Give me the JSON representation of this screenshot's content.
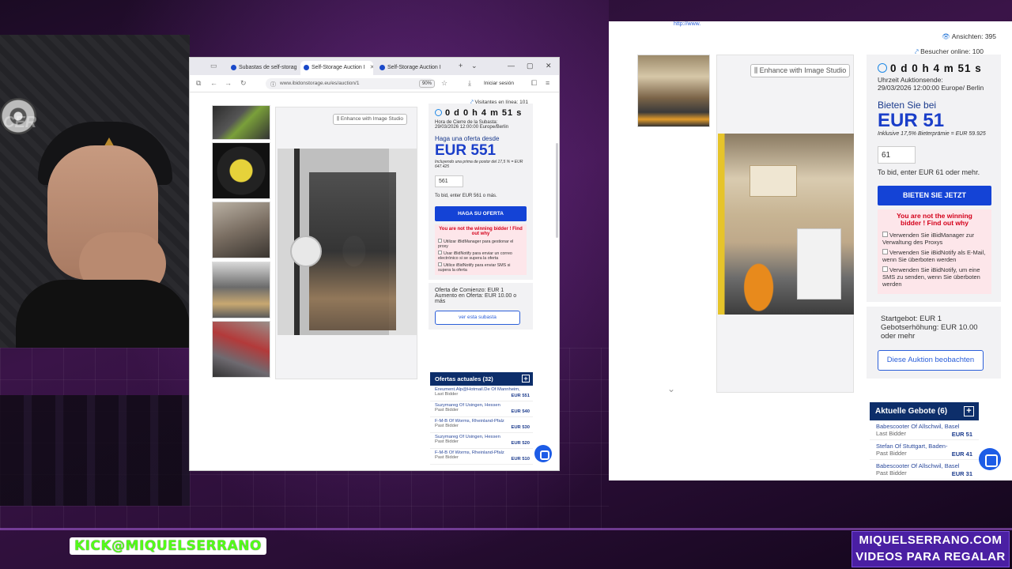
{
  "browser": {
    "tabs": [
      {
        "label": "Subastas de self-storag"
      },
      {
        "label": "Self-Storage Auction I"
      },
      {
        "label": "Self-Storage Auction I"
      }
    ],
    "url": "www.ibidonstorage.eu/es/auction/1",
    "zoom": "90%",
    "signin_label": "Iniciar sesión",
    "visitors_label": "Visitantes en línea: 101"
  },
  "auction_es": {
    "enhance_label": "Enhance with Image Studio",
    "timer": "0 d 0 h 4 m 51 s",
    "closing_label": "Hora de Cierre de la Subasta:",
    "closing_value": "29/03/2026 12:00:00 Europe/Berlin",
    "bid_from_label": "Haga una oferta desde",
    "price": "EUR 551",
    "premium_note": "Incluyendo una prima de postor del 17,5 % = EUR 647.425",
    "bid_value": "561",
    "to_bid_hint": "To bid, enter EUR 561 o más.",
    "bid_button": "HAGA SU OFERTA",
    "not_winning": "You are not the winning bidder ! Find out why",
    "options": [
      "Utilizar iBidManager para gestionar el proxy",
      "Usar iBidNotify para enviar un correo electrónico si se supera la oferta",
      "Utilice iBidNotify para enviar SMS si supera la oferta"
    ],
    "start_bid": "Oferta de Comienzo: EUR 1",
    "increment": "Aumento en Oferta: EUR 10.00 o más",
    "watch_button": "ver esta subasta",
    "offers_header": "Ofertas actuales (32)",
    "offers": [
      {
        "who": "Ereument.Alp@Hotmail.De Of Mannheim,",
        "status": "Last Bidder",
        "amount": "EUR 551"
      },
      {
        "who": "Suzymareg Of Usingen, Hessen",
        "status": "Past Bidder",
        "amount": "EUR 540"
      },
      {
        "who": "F-M-B Of Worms, Rheinland-Pfalz",
        "status": "Past Bidder",
        "amount": "EUR 530"
      },
      {
        "who": "Suzymareg Of Usingen, Hessen",
        "status": "Past Bidder",
        "amount": "EUR 520"
      },
      {
        "who": "F-M-B Of Worms, Rheinland-Pfalz",
        "status": "Past Bidder",
        "amount": "EUR 510"
      }
    ]
  },
  "auction_de": {
    "link": "http://www.",
    "views": "Ansichten: 395",
    "online": "Besucher online: 100",
    "enhance_label": "Enhance with Image Studio",
    "timer": "0 d 0 h 4 m 51 s",
    "closing_label": "Uhrzeit Auktionsende:",
    "closing_value": "29/03/2026 12:00:00 Europe/ Berlin",
    "bid_from_label": "Bieten Sie bei",
    "price": "EUR 51",
    "premium_note": "Inklusive 17,5% Bieterprämie = EUR 59.925",
    "bid_value": "61",
    "to_bid_hint": "To bid, enter EUR 61 oder mehr.",
    "bid_button": "BIETEN SIE JETZT",
    "not_winning_line1": "You are not the winning",
    "not_winning_line2": "bidder ! Find out why",
    "options": [
      "Verwenden Sie iBidManager zur Verwaltung des Proxys",
      "Verwenden Sie iBidNotify als E-Mail, wenn Sie überboten werden",
      "Verwenden Sie iBidNotify, um eine SMS zu senden, wenn Sie überboten werden"
    ],
    "start_bid": "Startgebot: EUR 1",
    "increment": "Gebotserhöhung: EUR 10.00 oder mehr",
    "watch_button": "Diese Auktion beobachten",
    "offers_header": "Aktuelle Gebote (6)",
    "offers": [
      {
        "who": "Babescooter Of Allschwil, Basel",
        "status": "Last Bidder",
        "amount": "EUR 51"
      },
      {
        "who": "Stefan Of Stuttgart, Baden-",
        "status": "Past Bidder",
        "amount": "EUR 41"
      },
      {
        "who": "Babescooter Of Allschwil, Basel",
        "status": "Past Bidder",
        "amount": "EUR 31"
      }
    ]
  },
  "overlay": {
    "kick_brand": "KICK",
    "kick_handle": "@MIQUELSERRANO",
    "promo_line1": "MIQUELSERRANO.COM",
    "promo_line2": "VIDEOS PARA REGALAR"
  },
  "colors": {
    "accent_blue": "#1443d6",
    "price_blue": "#1a3ec9",
    "warning_red": "#d4001a",
    "navy_header": "#0d2e6a",
    "kick_green": "#53fc18",
    "promo_purple": "#4a1fa3"
  }
}
